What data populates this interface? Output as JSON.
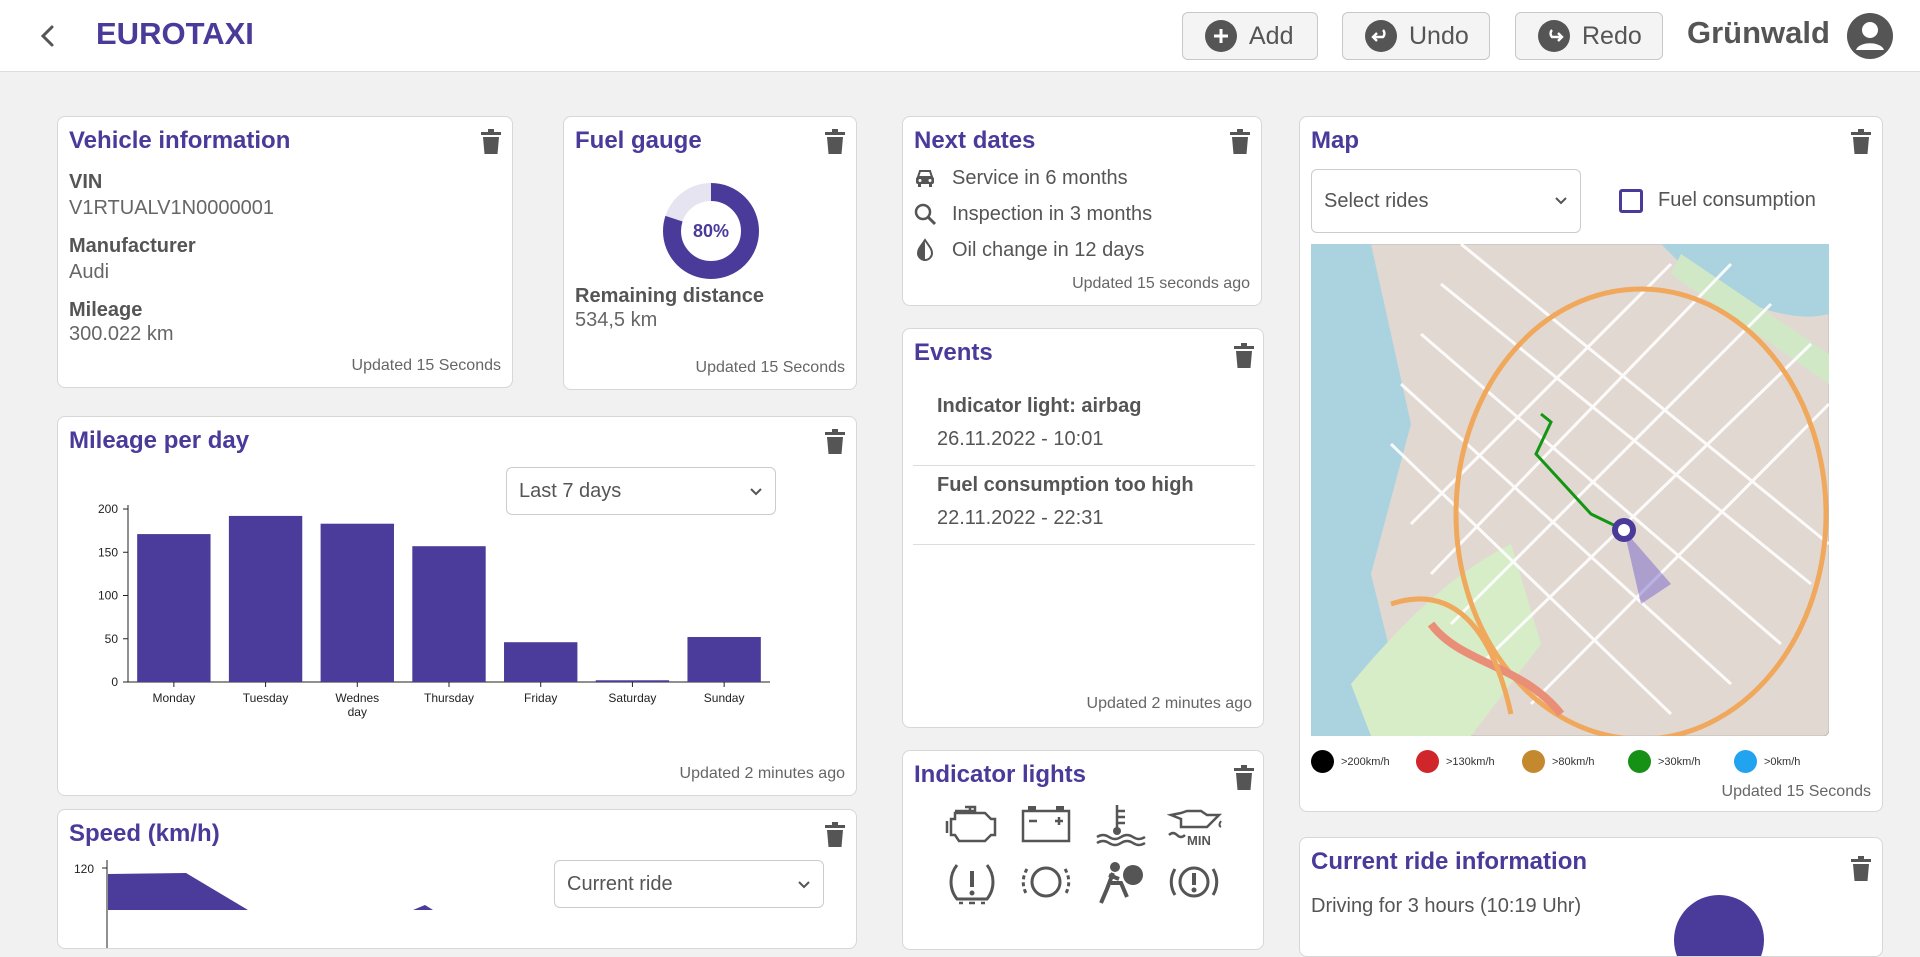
{
  "app": {
    "brand": "EUROTAXI",
    "user": "Grünwald"
  },
  "toolbar": {
    "add_label": "Add",
    "undo_label": "Undo",
    "redo_label": "Redo"
  },
  "vehicle": {
    "title": "Vehicle information",
    "vin_label": "VIN",
    "vin": "V1RTUALV1N0000001",
    "manufacturer_label": "Manufacturer",
    "manufacturer": "Audi",
    "mileage_label": "Mileage",
    "mileage": "300.022 km",
    "updated": "Updated 15 Seconds"
  },
  "fuel": {
    "title": "Fuel gauge",
    "percent_label": "80%",
    "percent": 0.8,
    "remaining_label": "Remaining distance",
    "remaining": "534,5 km",
    "updated": "Updated 15 Seconds"
  },
  "next_dates": {
    "title": "Next dates",
    "items": [
      {
        "icon": "car-icon",
        "text": "Service in 6 months"
      },
      {
        "icon": "search-icon",
        "text": "Inspection in 3 months"
      },
      {
        "icon": "oil-drop-icon",
        "text": "Oil change in 12 days"
      }
    ],
    "updated": "Updated 15 seconds ago"
  },
  "events": {
    "title": "Events",
    "items": [
      {
        "title": "Indicator light: airbag",
        "date": "26.11.2022 - 10:01"
      },
      {
        "title": "Fuel consumption too high",
        "date": "22.11.2022 - 22:31"
      }
    ],
    "updated": "Updated 2 minutes ago"
  },
  "indicator_lights": {
    "title": "Indicator lights",
    "icons": [
      "engine-icon",
      "battery-icon",
      "coolant-temp-icon",
      "oil-level-icon",
      "tire-pressure-icon",
      "brake-pad-icon",
      "airbag-icon",
      "brake-warning-icon"
    ],
    "oil_min_label": "MIN"
  },
  "map": {
    "title": "Map",
    "select": "Select rides",
    "checkbox_label": "Fuel consumption",
    "legend": [
      {
        "label": ">200km/h",
        "color": "#000000"
      },
      {
        "label": ">130km/h",
        "color": "#d0262b"
      },
      {
        "label": ">80km/h",
        "color": "#c4892f"
      },
      {
        "label": ">30km/h",
        "color": "#169116"
      },
      {
        "label": ">0km/h",
        "color": "#22a3f0"
      }
    ],
    "updated": "Updated 15 Seconds"
  },
  "current_ride": {
    "title": "Current ride information",
    "text": "Driving for 3 hours (10:19 Uhr)"
  },
  "speed": {
    "title": "Speed (km/h)",
    "select": "Current ride",
    "ytick_top": "120"
  },
  "mileage_chart": {
    "title": "Mileage per day",
    "select": "Last 7 days",
    "updated": "Updated 2 minutes ago"
  },
  "colors": {
    "accent": "#4a3a9a",
    "bar": "#4b3b9a"
  },
  "chart_data": {
    "type": "bar",
    "categories": [
      "Monday",
      "Tuesday",
      "Wednesday",
      "Thursday",
      "Friday",
      "Saturday",
      "Sunday"
    ],
    "category_labels": [
      [
        "Monday"
      ],
      [
        "Tuesday"
      ],
      [
        "Wednes",
        "day"
      ],
      [
        "Thursday"
      ],
      [
        "Friday"
      ],
      [
        "Saturday"
      ],
      [
        "Sunday"
      ]
    ],
    "values": [
      171,
      192,
      183,
      157,
      46,
      2,
      52
    ],
    "yticks": [
      0,
      50,
      100,
      150,
      200
    ],
    "ylim": [
      0,
      200
    ]
  }
}
